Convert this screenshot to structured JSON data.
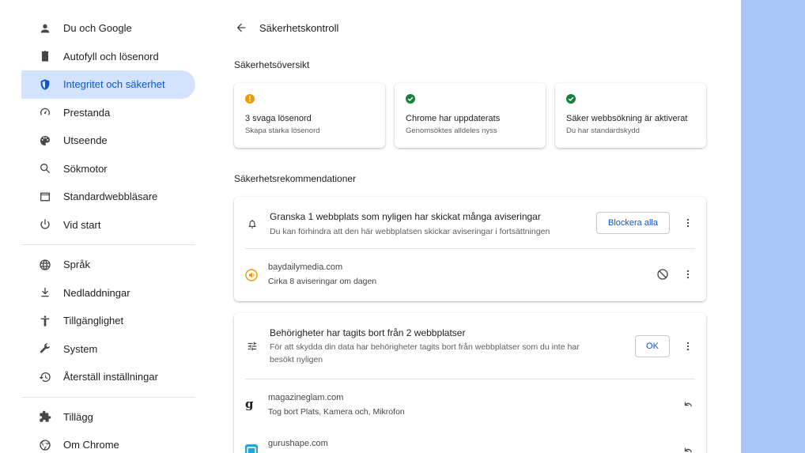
{
  "sidebar": {
    "items": [
      {
        "label": "Du och Google",
        "icon": "person-icon"
      },
      {
        "label": "Autofyll och lösenord",
        "icon": "clipboard-icon"
      },
      {
        "label": "Integritet och säkerhet",
        "icon": "shield-icon",
        "active": true
      },
      {
        "label": "Prestanda",
        "icon": "speedometer-icon"
      },
      {
        "label": "Utseende",
        "icon": "palette-icon"
      },
      {
        "label": "Sökmotor",
        "icon": "search-icon"
      },
      {
        "label": "Standardwebbläsare",
        "icon": "browser-icon"
      },
      {
        "label": "Vid start",
        "icon": "power-icon"
      },
      {
        "label": "Språk",
        "icon": "globe-icon"
      },
      {
        "label": "Nedladdningar",
        "icon": "download-icon"
      },
      {
        "label": "Tillgänglighet",
        "icon": "accessibility-icon"
      },
      {
        "label": "System",
        "icon": "wrench-icon"
      },
      {
        "label": "Återställ inställningar",
        "icon": "restore-icon"
      },
      {
        "label": "Tillägg",
        "icon": "puzzle-icon"
      },
      {
        "label": "Om Chrome",
        "icon": "chrome-icon"
      }
    ]
  },
  "header": {
    "title": "Säkerhetskontroll"
  },
  "overview": {
    "title": "Säkerhetsöversikt",
    "cards": [
      {
        "status": "warning",
        "title": "3 svaga lösenord",
        "subtitle": "Skapa starka lösenord"
      },
      {
        "status": "ok",
        "title": "Chrome har uppdaterats",
        "subtitle": "Genomsöktes alldeles nyss"
      },
      {
        "status": "ok",
        "title": "Säker webbsökning är aktiverat",
        "subtitle": "Du har standardskydd"
      }
    ]
  },
  "recommendations": {
    "title": "Säkerhetsrekommendationer",
    "notifications": {
      "title": "Granska 1 webbplats som nyligen har skickat många aviseringar",
      "subtitle": "Du kan förhindra att den här webbplatsen skickar aviseringar i fortsättningen",
      "button": "Blockera alla",
      "sites": [
        {
          "name": "baydailymedia.com",
          "detail": "Cirka 8 aviseringar om dagen"
        }
      ]
    },
    "permissions": {
      "title": "Behörigheter har tagits bort från 2 webbplatser",
      "subtitle_line1": "För att skydda din data har behörigheter tagits bort från webbplatser som du inte har",
      "subtitle_line2": "besökt nyligen",
      "button": "OK",
      "sites": [
        {
          "name": "magazineglam.com",
          "detail": "Tog bort Plats, Kamera och, Mikrofon"
        },
        {
          "name": "gurushape.com",
          "detail": ""
        }
      ]
    }
  },
  "colors": {
    "accent": "#0b57d0",
    "active_bg": "#d3e3fd",
    "warning": "#f29900",
    "ok": "#188038",
    "right_pane": "#aac7fa"
  }
}
